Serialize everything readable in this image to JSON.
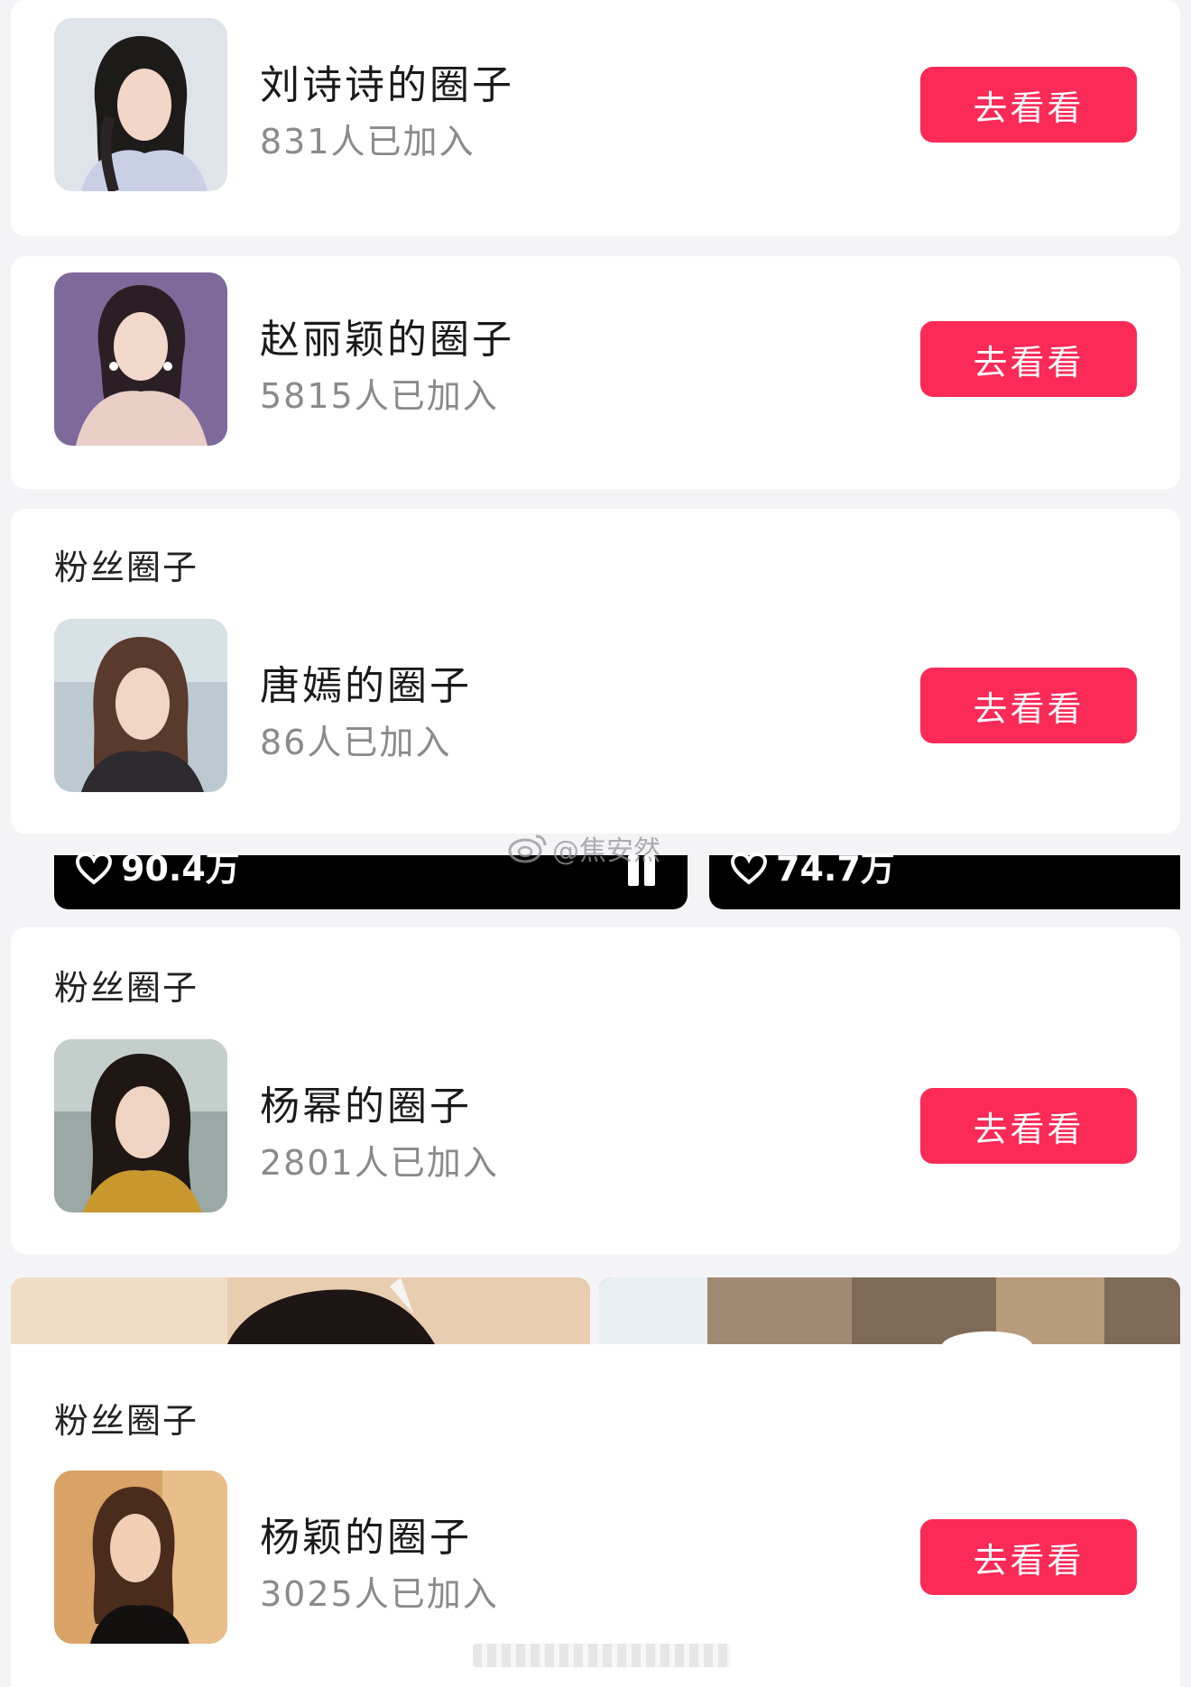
{
  "colors": {
    "accent": "#fb2a57",
    "background": "#f4f4f6",
    "card": "#ffffff"
  },
  "section_label": "粉丝圈子",
  "circles": [
    {
      "name": "刘诗诗的圈子",
      "members": "831人已加入",
      "button": "去看看"
    },
    {
      "name": "赵丽颖的圈子",
      "members": "5815人已加入",
      "button": "去看看"
    },
    {
      "name": "唐嫣的圈子",
      "members": "86人已加入",
      "button": "去看看"
    },
    {
      "name": "杨幂的圈子",
      "members": "2801人已加入",
      "button": "去看看"
    },
    {
      "name": "杨颖的圈子",
      "members": "3025人已加入",
      "button": "去看看"
    }
  ],
  "video_strip": {
    "left_likes": "90.4万",
    "right_likes": "74.7万",
    "icons": [
      "heart-icon",
      "pause-icon"
    ]
  },
  "watermark": "@焦安然"
}
